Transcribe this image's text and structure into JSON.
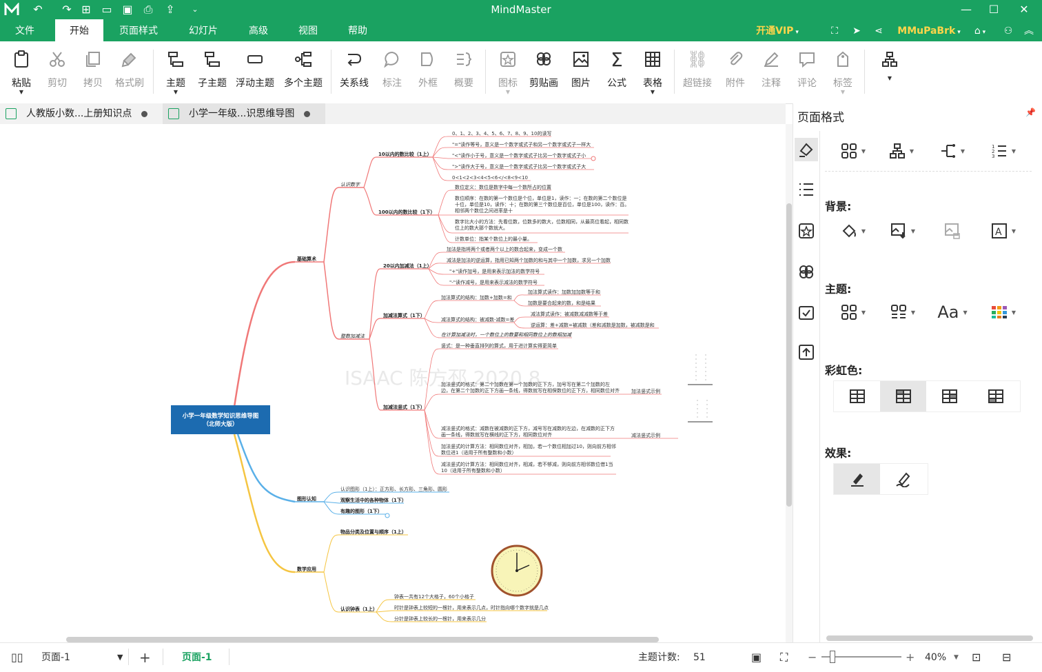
{
  "app": {
    "title": "MindMaster",
    "vip_label": "开通VIP",
    "user_name": "MMuPaBrk"
  },
  "menu": [
    "文件",
    "开始",
    "页面样式",
    "幻灯片",
    "高级",
    "视图",
    "帮助"
  ],
  "ribbon": {
    "paste": "粘贴",
    "cut": "剪切",
    "copy": "拷贝",
    "format_painter": "格式刷",
    "topic": "主题",
    "subtopic": "子主题",
    "floating_topic": "浮动主题",
    "multi_topic": "多个主题",
    "relation": "关系线",
    "callout": "标注",
    "boundary": "外框",
    "summary": "概要",
    "icon": "图标",
    "clipart": "剪贴画",
    "image": "图片",
    "formula": "公式",
    "table": "表格",
    "hyperlink": "超链接",
    "attachment": "附件",
    "note": "注释",
    "comment": "评论",
    "tag": "标签"
  },
  "tabs": [
    {
      "title": "人教版小数...上册知识点"
    },
    {
      "title": "小学一年级...识思维导图"
    }
  ],
  "mindmap": {
    "root": "小学一年级数学知识思维导图",
    "root_sub": "（北师大版）",
    "watermark": "ISAAC 陈方邳 2020.8",
    "branches": {
      "basic": "基础算术",
      "shapes": "图形认知",
      "apply": "数学应用"
    },
    "l2": {
      "know_num": "认识数字",
      "add_sub": "整数加减法",
      "num10": "10以内的数比较（1上）",
      "num100": "100以内的数比较（1下）",
      "add20": "20以内加减法（1上）",
      "addsub_formula": "加减法算式（1下）",
      "vertical": "加减法竖式（1下）",
      "shape1": "认识图形（1上）：正方形、长方形、三角形、圆形",
      "shape2": "观察生活中的各种物体（1下）",
      "shape3": "有趣的图形（1下）",
      "classify": "物品分类及位置与顺序（1上）",
      "clock": "认识钟表（1上）"
    },
    "leaves": {
      "n1": "0、1、2、3、4、5、6、7、8、9、10的读写",
      "n2": "\"=\"读作等号，意义是一个数字或式子和另一个数字或式子一样大",
      "n3": "\"<\"读作小于号，意义是一个数字或式子比另一个数字或式子小",
      "n4": "\">\"读作大于号，意义是一个数字或式子比另一个数字或式子大",
      "n5": "0<1<2<3<4<5<6</<8<9<10",
      "m1": "数位定义：数位是数字中每一个数所占的位置",
      "m2a": "数位顺序：在数的第一个数位是个位，单位是1，读作：一；在数的第二个数位是",
      "m2b": "十位，单位是10，读作：十；在数的第三个数位是百位，单位是100，读作：百。",
      "m2c": "相邻两个数位之间进率是十",
      "m3a": "数字比大小的方法：先看位数，位数多的数大，位数相同，从最高位看起，相同数",
      "m3b": "位上的数大那个数就大。",
      "m4": "计数单位：指某个数位上的最小量。",
      "a1": "加法是指将两个或者两个以上的数合起来，变成一个数",
      "a2": "减法是加法的逆运算，指用已知两个加数的和与其中一个加数，求另一个加数",
      "a3": "\"+\"读作加号，是用来表示加法的数学符号",
      "a4": "\"-\"读作减号，是用来表示减法的数学符号",
      "f1": "加法算式的结构：加数+加数=和",
      "f1a": "加法算式读作：加数加加数等于和",
      "f1b": "加数是要合起来的数，和是结果",
      "f2": "减法算式的结构：被减数-减数=差",
      "f2a": "减法算式读作：被减数减减数等于差",
      "f2b": "逆运算：差+减数=被减数（差和减数是加数，被减数是和",
      "f3": "在计算加减法时，一个数位上的数要和相同数位上的数相加减",
      "v1": "竖式：是一种垂直排列的算式，用于进计算实得更简单",
      "v2a": "加法竖式的格式：第二个加数在第一个加数的正下方，加号写在第二个加数的左",
      "v2b": "边，在第二个加数的正下方画一条线，得数就写在相保数位的正下方，相同数位对齐",
      "v2c": "加法竖式示例",
      "v3a": "减法竖式的格式：减数在被减数的正下方，减号写在减数的左边，在减数的正下方",
      "v3b": "画一条线，得数就写在横线的正下方，相同数位对齐",
      "v3c": "减法竖式示例",
      "v4a": "加法竖式的计算方法：相同数位对齐，相加，若一个数位相加过10，则向前方相邻",
      "v4b": "数位进1（适用于所有整数和小数）",
      "v5a": "减法竖式的计算方法：相同数位对齐，相减，若不够减，则向前方相邻数位借1当",
      "v5b": "10（适用于所有整数和小数）",
      "c1": "钟表一共有12个大格子，60个小格子",
      "c2": "时针是钟表上较短的一根针，用来表示几点，时针指向哪个数字就是几点",
      "c3": "分针是钟表上较长的一根针，用来表示几分"
    }
  },
  "panel": {
    "title": "页面格式",
    "background": "背景:",
    "theme": "主题:",
    "rainbow": "彩虹色:",
    "effects": "效果:",
    "font_sample": "Aa"
  },
  "status": {
    "page_select": "页面-1",
    "page_tab": "页面-1",
    "topic_count_label": "主题计数:",
    "topic_count": "51",
    "zoom": "40%"
  },
  "colors": {
    "brand": "#1aa261",
    "vip": "#ffd54a",
    "root": "#1c6bb0",
    "branch_red": "#f07878",
    "branch_blue": "#5ab0e8",
    "branch_yellow": "#f5c542"
  }
}
